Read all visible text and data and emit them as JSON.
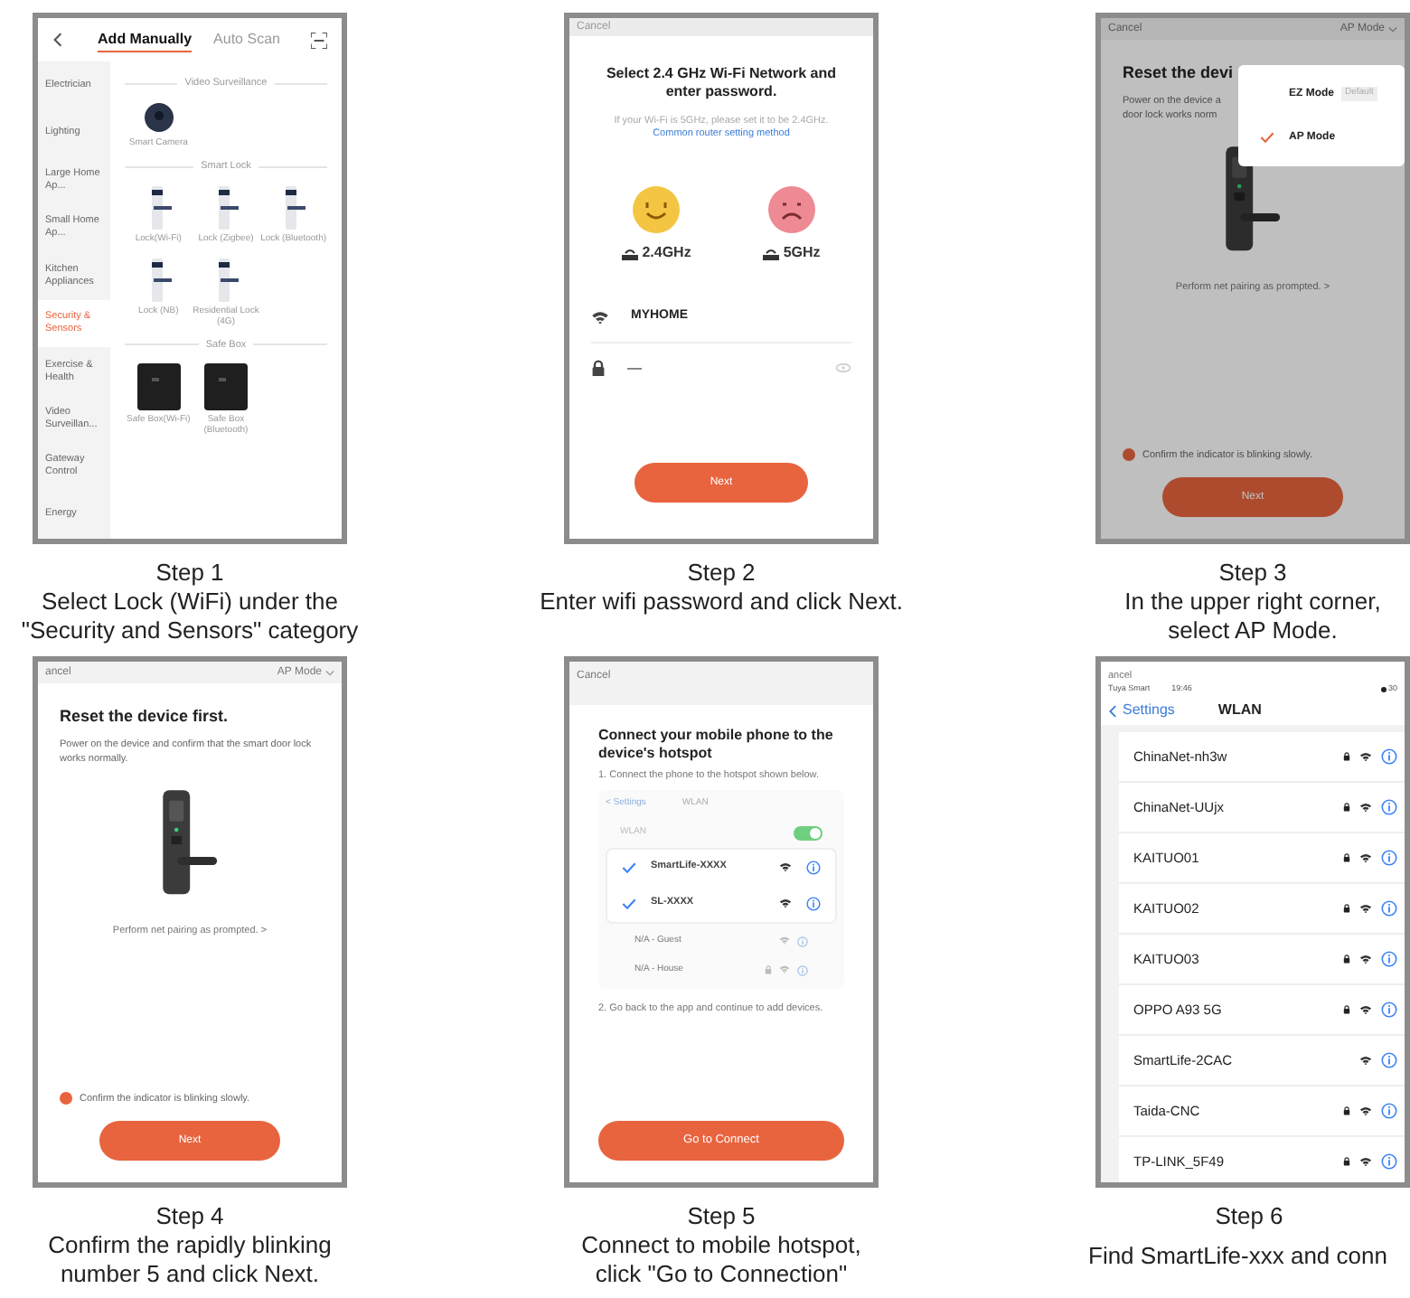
{
  "steps": [
    {
      "kind": "categories",
      "screen": {
        "tabs": [
          {
            "label": "Add Manually",
            "selected": true
          },
          {
            "label": "Auto Scan",
            "selected": false
          }
        ],
        "categories": [
          {
            "label": "Electrician",
            "selected": false
          },
          {
            "label": "Lighting",
            "selected": false
          },
          {
            "label": "Large Home Ap...",
            "selected": false
          },
          {
            "label": "Small Home Ap...",
            "selected": false
          },
          {
            "label": "Kitchen Appliances",
            "selected": false
          },
          {
            "label": "Security & Sensors",
            "selected": true
          },
          {
            "label": "Exercise & Health",
            "selected": false
          },
          {
            "label": "Video Surveillan...",
            "selected": false
          },
          {
            "label": "Gateway Control",
            "selected": false
          },
          {
            "label": "Energy",
            "selected": false
          }
        ],
        "sections": [
          {
            "title": "Video Surveillance",
            "items": [
              {
                "kind": "camera",
                "label": "Smart Camera"
              }
            ]
          },
          {
            "title": "Smart Lock",
            "items": [
              {
                "kind": "lock",
                "label": "Lock(Wi-Fi)"
              },
              {
                "kind": "lock",
                "label": "Lock (Zigbee)"
              },
              {
                "kind": "lock",
                "label": "Lock (Bluetooth)"
              },
              {
                "kind": "lock",
                "label": "Lock (NB)"
              },
              {
                "kind": "lock",
                "label": "Residential Lock (4G)"
              }
            ]
          },
          {
            "title": "Safe Box",
            "items": [
              {
                "kind": "safe",
                "label": "Safe Box(Wi-Fi)"
              },
              {
                "kind": "safe",
                "label": "Safe Box (Bluetooth)"
              }
            ]
          }
        ]
      },
      "caption": {
        "heading": "Step 1",
        "lines": [
          "Select Lock (WiFi) under the",
          "\"Security and Sensors\" category"
        ]
      }
    },
    {
      "kind": "wifi",
      "screen": {
        "cancel": "Cancel",
        "title": "Select 2.4 GHz Wi-Fi Network and enter password.",
        "hint": "If your Wi-Fi is 5GHz, please set it to be 2.4GHz.",
        "link": "Common router setting method",
        "bands": [
          {
            "kind": "happy",
            "label": "2.4GHz"
          },
          {
            "kind": "sad",
            "label": "5GHz"
          }
        ],
        "network": "MYHOME",
        "password": "—",
        "button": "Next"
      },
      "caption": {
        "heading": "Step 2",
        "lines": [
          "Enter wifi password and click Next."
        ]
      }
    },
    {
      "kind": "reset",
      "screen": {
        "cancel": "Cancel",
        "mode": "AP Mode",
        "title": "Reset the devi",
        "desc": [
          "Power on the device a",
          "door lock works norm"
        ],
        "prompt": "Perform net pairing as prompted. >",
        "confirm": {
          "label": "Confirm the indicator is blinking slowly.",
          "checked": true
        },
        "button": "Next",
        "menu": [
          {
            "label": "EZ Mode",
            "badge": "Default",
            "selected": false
          },
          {
            "label": "AP Mode",
            "selected": true
          }
        ]
      },
      "caption": {
        "heading": "Step 3",
        "lines": [
          "In the upper right corner,",
          "select AP Mode."
        ]
      }
    },
    {
      "kind": "reset",
      "screen": {
        "cancel": "ancel",
        "mode": "AP Mode",
        "title": "Reset the device first.",
        "desc": [
          "Power on the device and confirm that the smart door lock works normally."
        ],
        "prompt": "Perform net pairing as prompted. >",
        "confirm": {
          "label": "Confirm the indicator is blinking slowly.",
          "checked": true
        },
        "button": "Next"
      },
      "caption": {
        "heading": "Step 4",
        "lines": [
          "Confirm the rapidly blinking",
          "number 5 and click Next."
        ]
      }
    },
    {
      "kind": "hotspot",
      "screen": {
        "cancel": "Cancel",
        "title": "Connect your mobile phone to the device's hotspot",
        "step1": "1. Connect the phone to the hotspot shown below.",
        "mock": {
          "back": "< Settings",
          "title": "WLAN",
          "wlan": {
            "label": "WLAN",
            "on": true
          },
          "networks": [
            {
              "name": "SmartLife-XXXX",
              "selected": true
            },
            {
              "name": "SL-XXXX",
              "selected": true
            }
          ],
          "others": [
            {
              "name": "N/A - Guest",
              "locked": false
            },
            {
              "name": "N/A - House",
              "locked": true
            }
          ]
        },
        "step2": "2. Go back to the app and continue to add devices.",
        "button": "Go to Connect"
      },
      "caption": {
        "heading": "Step 5",
        "lines": [
          "Connect to mobile hotspot,",
          "click \"Go to Connection\""
        ]
      }
    },
    {
      "kind": "wlan",
      "screen": {
        "cancel": "ancel",
        "carrier": "Tuya Smart",
        "time": "19:46",
        "battery": "30",
        "back": "Settings",
        "title": "WLAN",
        "networks": [
          {
            "name": "ChinaNet-nh3w",
            "locked": true
          },
          {
            "name": "ChinaNet-UUjx",
            "locked": true
          },
          {
            "name": "KAITUO01",
            "locked": true
          },
          {
            "name": "KAITUO02",
            "locked": true
          },
          {
            "name": "KAITUO03",
            "locked": true
          },
          {
            "name": "OPPO A93 5G",
            "locked": true
          },
          {
            "name": "SmartLife-2CAC",
            "locked": false
          },
          {
            "name": "Taida-CNC",
            "locked": true
          },
          {
            "name": "TP-LINK_5F49",
            "locked": true
          }
        ]
      },
      "caption": {
        "heading": "Step 6",
        "lines": [
          "Find SmartLife-xxx and conn"
        ]
      }
    }
  ]
}
